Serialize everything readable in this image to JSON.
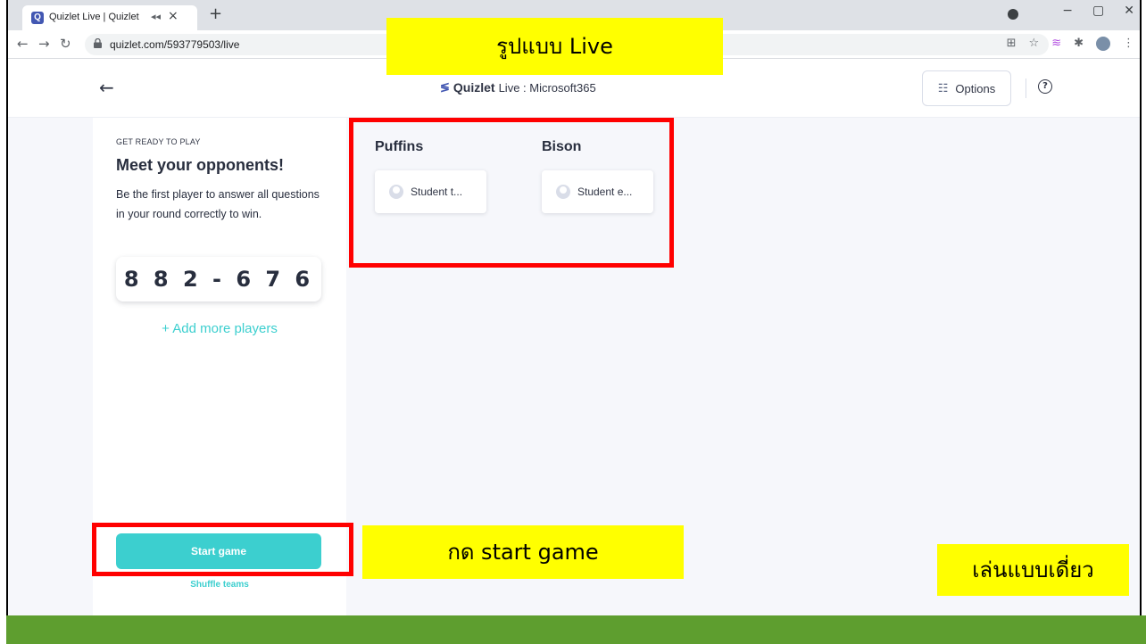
{
  "browser": {
    "tab_title": "Quizlet Live | Quizlet",
    "tab_favicon_letter": "Q",
    "url": "quizlet.com/593779503/live",
    "window_controls": [
      "−",
      "▢",
      "✕"
    ]
  },
  "header": {
    "brand_word": "Quizlet",
    "brand_rest": "Live : Microsoft365",
    "options_label": "Options",
    "help_symbol": "?"
  },
  "left_panel": {
    "eyebrow": "GET READY TO PLAY",
    "title": "Meet your opponents!",
    "description": "Be the first player to answer all questions in your round correctly to win.",
    "join_code": "882-676",
    "add_players": "+ Add more players",
    "start_button": "Start game",
    "shuffle": "Shuffle teams"
  },
  "teams": [
    {
      "name": "Puffins",
      "players": [
        "Student t..."
      ]
    },
    {
      "name": "Bison",
      "players": [
        "Student e..."
      ]
    }
  ],
  "annotations": {
    "top_label": "รูปแบบ Live",
    "start_label": "กด start game",
    "mode_label": "เล่นแบบเดี่ยว"
  },
  "colors": {
    "accent_teal": "#3ccfcf",
    "quizlet_blue": "#4257b2",
    "highlight_yellow": "#ffff00",
    "annotation_red": "#ff0000",
    "footer_green": "#5e9e2f"
  }
}
